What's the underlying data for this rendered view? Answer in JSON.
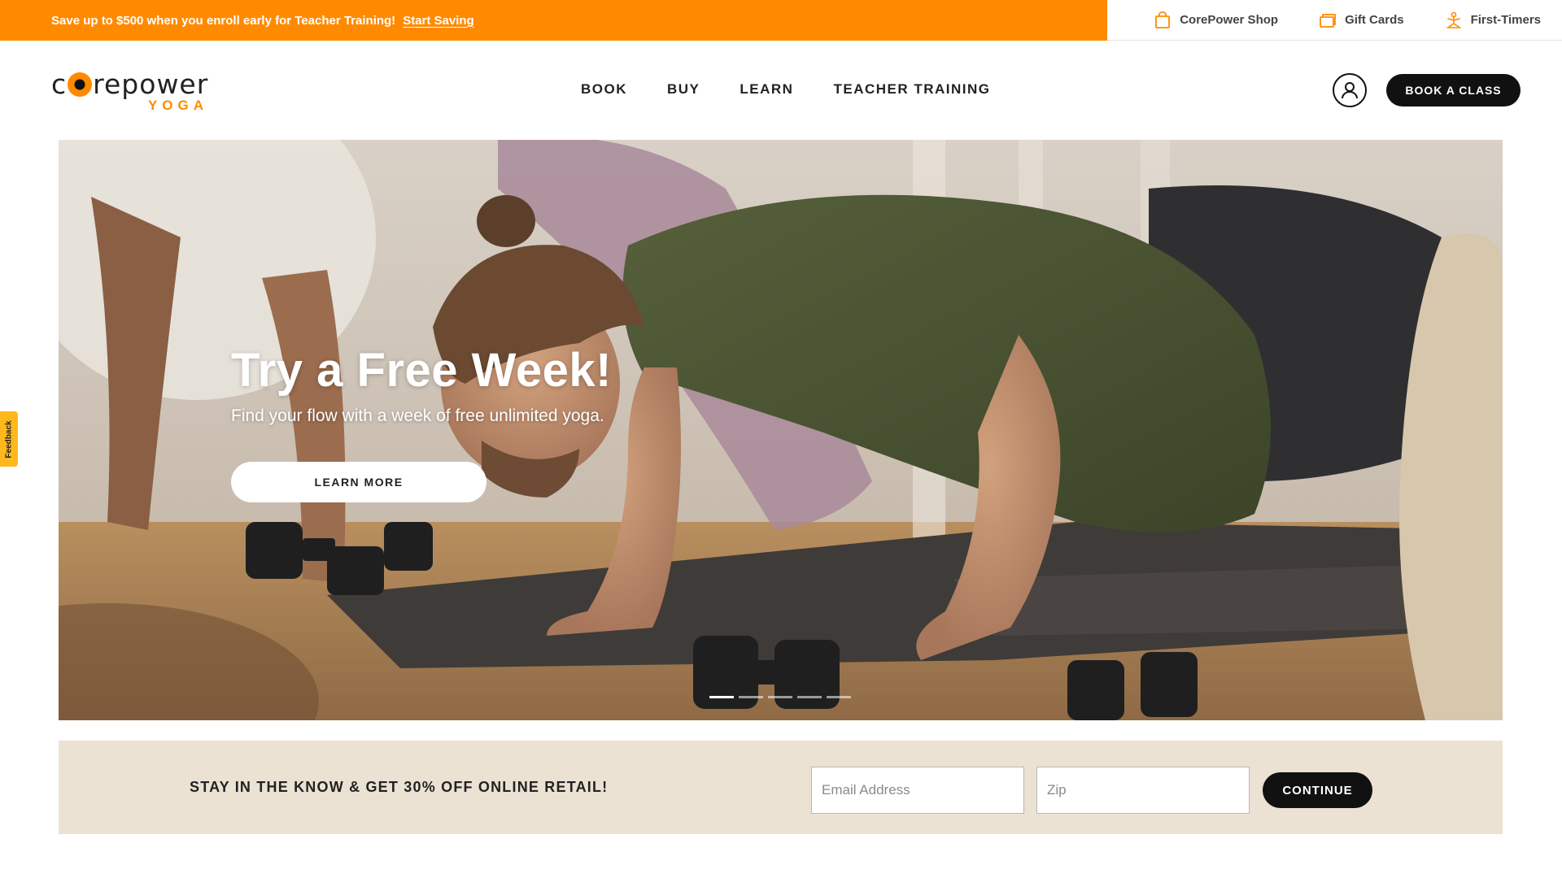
{
  "promo_bar": {
    "message": "Save up to $500 when you enroll early for Teacher Training!",
    "cta": "Start Saving",
    "background": "#ff8a00"
  },
  "utility_links": [
    {
      "label": "CorePower Shop",
      "icon": "shopping-bag-icon"
    },
    {
      "label": "Gift Cards",
      "icon": "gift-card-icon"
    },
    {
      "label": "First-Timers",
      "icon": "yoga-pose-icon"
    }
  ],
  "header": {
    "logo": {
      "word": "repower",
      "sub": "YOGA"
    },
    "nav": [
      {
        "label": "BOOK"
      },
      {
        "label": "BUY"
      },
      {
        "label": "LEARN"
      },
      {
        "label": "TEACHER TRAINING"
      }
    ],
    "account_icon": "user-icon",
    "book_button": "BOOK A CLASS"
  },
  "hero": {
    "title": "Try a Free Week!",
    "subtitle": "Find your flow with a week of free unlimited yoga.",
    "cta": "LEARN MORE",
    "slides": 5,
    "active_slide": 1
  },
  "feedback_tab": {
    "label": "Feedback",
    "color": "#ffb81c"
  },
  "newsletter": {
    "text": "STAY IN THE KNOW & GET 30% OFF ONLINE RETAIL!",
    "email_placeholder": "Email Address",
    "zip_placeholder": "Zip",
    "button": "CONTINUE",
    "background": "#ebe2d4"
  }
}
